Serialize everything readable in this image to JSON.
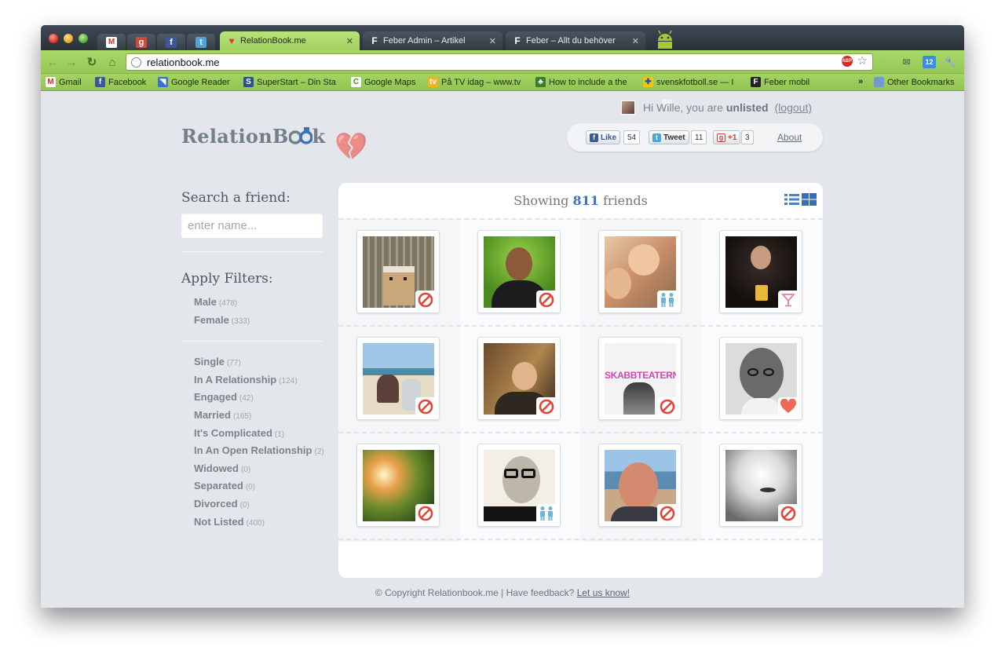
{
  "browser": {
    "tabs": [
      {
        "title": "RelationBook.me",
        "icon": "heart-icon",
        "active": true
      },
      {
        "title": "Feber Admin – Artikel",
        "icon": "feber-icon",
        "active": false
      },
      {
        "title": "Feber – Allt du behöver",
        "icon": "feber-icon",
        "active": false
      }
    ],
    "url": "relationbook.me",
    "extension_badge": "12",
    "bookmarks": [
      {
        "label": "Gmail",
        "icon": "gmail-icon"
      },
      {
        "label": "Facebook",
        "icon": "facebook-icon"
      },
      {
        "label": "Google Reader",
        "icon": "google-reader-icon"
      },
      {
        "label": "SuperStart – Din Sta",
        "icon": "superstart-icon"
      },
      {
        "label": "Google Maps",
        "icon": "google-maps-icon"
      },
      {
        "label": "På TV idag – www.tv",
        "icon": "tv-icon"
      },
      {
        "label": "How to include a the",
        "icon": "bookmark-icon"
      },
      {
        "label": "svenskfotboll.se — I",
        "icon": "svenskfotboll-icon"
      },
      {
        "label": "Feber mobil",
        "icon": "feber-icon"
      }
    ],
    "overflow_label": "»",
    "other_bookmarks": "Other Bookmarks"
  },
  "header": {
    "greeting": "Hi Wille, you are",
    "status": "unlisted",
    "logout": "(logout)",
    "logo_text": "RelationBook",
    "social": {
      "like_label": "Like",
      "like_count": "54",
      "tweet_label": "Tweet",
      "tweet_count": "11",
      "plusone_label": "+1",
      "plusone_count": "3"
    },
    "about": "About"
  },
  "sidebar": {
    "search_title": "Search a friend:",
    "search_placeholder": "enter name...",
    "filters_title": "Apply Filters:",
    "gender_filters": [
      {
        "label": "Male",
        "count": "(478)"
      },
      {
        "label": "Female",
        "count": "(333)"
      }
    ],
    "relationship_filters": [
      {
        "label": "Single",
        "count": "(77)"
      },
      {
        "label": "In A Relationship",
        "count": "(124)"
      },
      {
        "label": "Engaged",
        "count": "(42)"
      },
      {
        "label": "Married",
        "count": "(165)"
      },
      {
        "label": "It's Complicated",
        "count": "(1)"
      },
      {
        "label": "In An Open Relationship",
        "count": "(2)"
      },
      {
        "label": "Widowed",
        "count": "(0)"
      },
      {
        "label": "Separated",
        "count": "(0)"
      },
      {
        "label": "Divorced",
        "count": "(0)"
      },
      {
        "label": "Not Listed",
        "count": "(400)"
      }
    ]
  },
  "main": {
    "showing_prefix": "Showing",
    "showing_count": "811",
    "showing_suffix": "friends",
    "friends": [
      {
        "status_icon": "not-listed-icon",
        "photo_text": ""
      },
      {
        "status_icon": "not-listed-icon",
        "photo_text": ""
      },
      {
        "status_icon": "couple-icon",
        "photo_text": ""
      },
      {
        "status_icon": "cocktail-icon",
        "photo_text": ""
      },
      {
        "status_icon": "not-listed-icon",
        "photo_text": ""
      },
      {
        "status_icon": "not-listed-icon",
        "photo_text": ""
      },
      {
        "status_icon": "not-listed-icon",
        "photo_text": "SKABBTEATERN"
      },
      {
        "status_icon": "heart-icon",
        "photo_text": ""
      },
      {
        "status_icon": "not-listed-icon",
        "photo_text": ""
      },
      {
        "status_icon": "couple-icon",
        "photo_text": ""
      },
      {
        "status_icon": "not-listed-icon",
        "photo_text": ""
      },
      {
        "status_icon": "not-listed-icon",
        "photo_text": ""
      }
    ]
  },
  "footer": {
    "text": "© Copyright Relationbook.me | Have feedback?",
    "link": "Let us know!"
  },
  "colors": {
    "accent": "#3f73b6",
    "not_listed": "#e0473a",
    "couple": "#6cb6d1",
    "heart": "#ee6a55",
    "cocktail": "#e37fa8",
    "browser_green": "#a3d363"
  }
}
